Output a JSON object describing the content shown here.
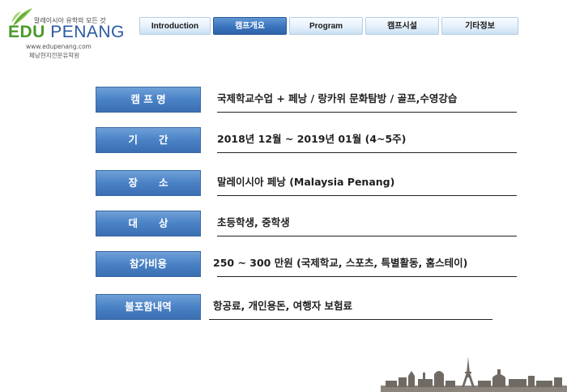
{
  "logo": {
    "tagline": "말레이시아 유학의 모든 것",
    "brand_edu": "EDU",
    "brand_penang": "PENANG",
    "url": "www.edupenang.com",
    "subtitle": "페낭현지전문유학원",
    "colors": {
      "edu": "#4a9a2a",
      "penang": "#2a5aa0"
    }
  },
  "nav": {
    "tabs": [
      {
        "label": "Introduction",
        "active": false
      },
      {
        "label": "캠프개요",
        "active": true
      },
      {
        "label": "Program",
        "active": false
      },
      {
        "label": "캠프시설",
        "active": false
      },
      {
        "label": "기타정보",
        "active": false
      }
    ],
    "colors": {
      "active": "#3a74bd",
      "inactive": "#e4f0fb"
    }
  },
  "info": {
    "rows": [
      {
        "label": "캠 프 명",
        "value": "국제학교수업  + 페낭 / 랑카위 문화탐방 / 골프,수영강습"
      },
      {
        "label": "기      간",
        "value": "2018년 12월 ~ 2019년 01월  (4~5주)"
      },
      {
        "label": "장      소",
        "value": "말레이시아 페낭 (Malaysia Penang)"
      },
      {
        "label": "대      상",
        "value": "초등학생, 중학생"
      },
      {
        "label": "참가비용",
        "value": "250 ~ 300 만원  (국제학교, 스포츠, 특별활동, 홈스테이)"
      },
      {
        "label": "불포함내역",
        "value": "항공료, 개인용돈, 여행자 보험료"
      }
    ],
    "colors": {
      "label_bg": "#4a82c6"
    }
  }
}
